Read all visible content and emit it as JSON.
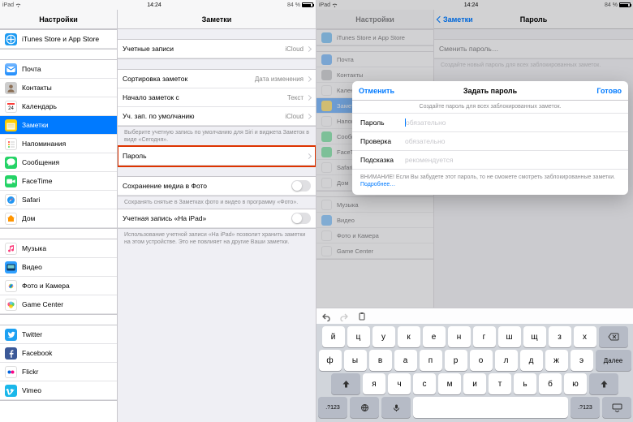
{
  "status": {
    "device": "iPad",
    "time": "14:24",
    "battery_pct": "84 %"
  },
  "sidebar_title": "Настройки",
  "detail_title": "Заметки",
  "sidebar": {
    "items": [
      {
        "label": "iTunes Store и App Store",
        "color": "#1e9bf2",
        "icon": "appstore"
      },
      {
        "label": "Почта",
        "color": "#1f8dfc",
        "icon": "mail"
      },
      {
        "label": "Контакты",
        "color": "#a7a9ad",
        "icon": "contacts"
      },
      {
        "label": "Календарь",
        "color": "#ffffff",
        "icon": "calendar"
      },
      {
        "label": "Заметки",
        "color": "#ffcc00",
        "icon": "notes"
      },
      {
        "label": "Напоминания",
        "color": "#ffffff",
        "icon": "reminders"
      },
      {
        "label": "Сообщения",
        "color": "#25d366",
        "icon": "messages"
      },
      {
        "label": "FaceTime",
        "color": "#25d366",
        "icon": "facetime"
      },
      {
        "label": "Safari",
        "color": "#ffffff",
        "icon": "safari"
      },
      {
        "label": "Дом",
        "color": "#ffffff",
        "icon": "home"
      },
      {
        "label": "Музыка",
        "color": "#ffffff",
        "icon": "music"
      },
      {
        "label": "Видео",
        "color": "#30a0ff",
        "icon": "video"
      },
      {
        "label": "Фото и Камера",
        "color": "#ffffff",
        "icon": "photos"
      },
      {
        "label": "Game Center",
        "color": "#ffffff",
        "icon": "gamecenter"
      },
      {
        "label": "Twitter",
        "color": "#1da1f2",
        "icon": "twitter"
      },
      {
        "label": "Facebook",
        "color": "#3b5998",
        "icon": "facebook"
      },
      {
        "label": "Flickr",
        "color": "#ffffff",
        "icon": "flickr"
      },
      {
        "label": "Vimeo",
        "color": "#1ab7ea",
        "icon": "vimeo"
      }
    ]
  },
  "detail": {
    "accounts": {
      "label": "Учетные записи",
      "value": "iCloud"
    },
    "sort": {
      "label": "Сортировка заметок",
      "value": "Дата изменения"
    },
    "startwith": {
      "label": "Начало заметок с",
      "value": "Текст"
    },
    "default": {
      "label": "Уч. зап. по умолчанию",
      "value": "iCloud"
    },
    "default_footer": "Выберите учетную запись по умолчанию для Siri и виджета Заметок в виде «Сегодня».",
    "password": {
      "label": "Пароль"
    },
    "savephoto": {
      "label": "Сохранение медиа в Фото"
    },
    "savephoto_footer": "Сохранять снятые в Заметках фото и видео в программу «Фото».",
    "onipad": {
      "label": "Учетная запись «На iPad»"
    },
    "onipad_footer": "Использование учетной записи «На iPad» позволит хранить заметки на этом устройстве. Это не повлияет на другие Ваши заметки."
  },
  "right": {
    "back": "Заметки",
    "title": "Пароль",
    "change": "Сменить пароль…",
    "change_footer": "Создайте новый пароль для всех заблокированных заметок.",
    "modal": {
      "cancel": "Отменить",
      "title": "Задать пароль",
      "done": "Готово",
      "note": "Создайте пароль для всех заблокированных заметок.",
      "f1": "Пароль",
      "p1": "обязательно",
      "f2": "Проверка",
      "p2": "обязательно",
      "f3": "Подсказка",
      "p3": "рекомендуется",
      "warn": "ВНИМАНИЕ! Если Вы забудете этот пароль, то не сможете смотреть заблокированные заметки. ",
      "more": "Подробнее…"
    }
  },
  "kb": {
    "r1": [
      "й",
      "ц",
      "у",
      "к",
      "е",
      "н",
      "г",
      "ш",
      "щ",
      "з",
      "х"
    ],
    "r2": [
      "ф",
      "ы",
      "в",
      "а",
      "п",
      "р",
      "о",
      "л",
      "д",
      "ж",
      "э"
    ],
    "r3": [
      "я",
      "ч",
      "с",
      "м",
      "и",
      "т",
      "ь",
      "б",
      "ю"
    ],
    "next": "Далее",
    "numkey": ".?123"
  }
}
